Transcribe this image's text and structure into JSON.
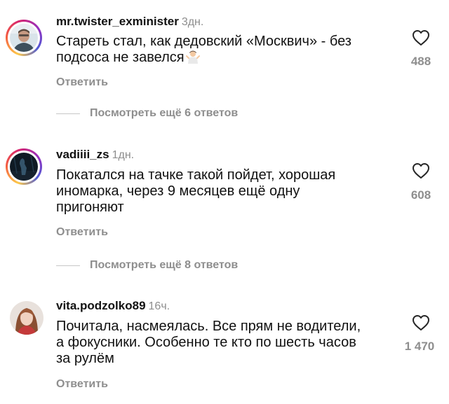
{
  "comments": [
    {
      "username": "mr.twister_exminister",
      "time": "3дн.",
      "lines": [
        "Стареть стал, как дедовский «Москвич» - без",
        "подсоса не завелся"
      ],
      "likes": "488",
      "reply": "Ответить",
      "more": "Посмотреть ещё 6 ответов"
    },
    {
      "username": "vadiiii_zs",
      "time": "1дн.",
      "lines": [
        "Покатался на тачке такой пойдет, хорошая",
        "иномарка, через 9 месяцев ещё одну",
        "пригоняют"
      ],
      "likes": "608",
      "reply": "Ответить",
      "more": "Посмотреть ещё 8 ответов"
    },
    {
      "username": "vita.podzolko89",
      "time": "16ч.",
      "lines": [
        "Почитала, насмеялась. Все прям не водители,",
        "а фокусники. Особенно те кто по шесть часов",
        "за рулём"
      ],
      "likes": "1 470",
      "reply": "Ответить"
    }
  ],
  "icons": {
    "like": "heart-outline-icon",
    "emoji": "person-shrugging-emoji"
  },
  "colors": {
    "text": "#111111",
    "muted": "#8e8e8e",
    "divider": "#c7c7c7"
  }
}
